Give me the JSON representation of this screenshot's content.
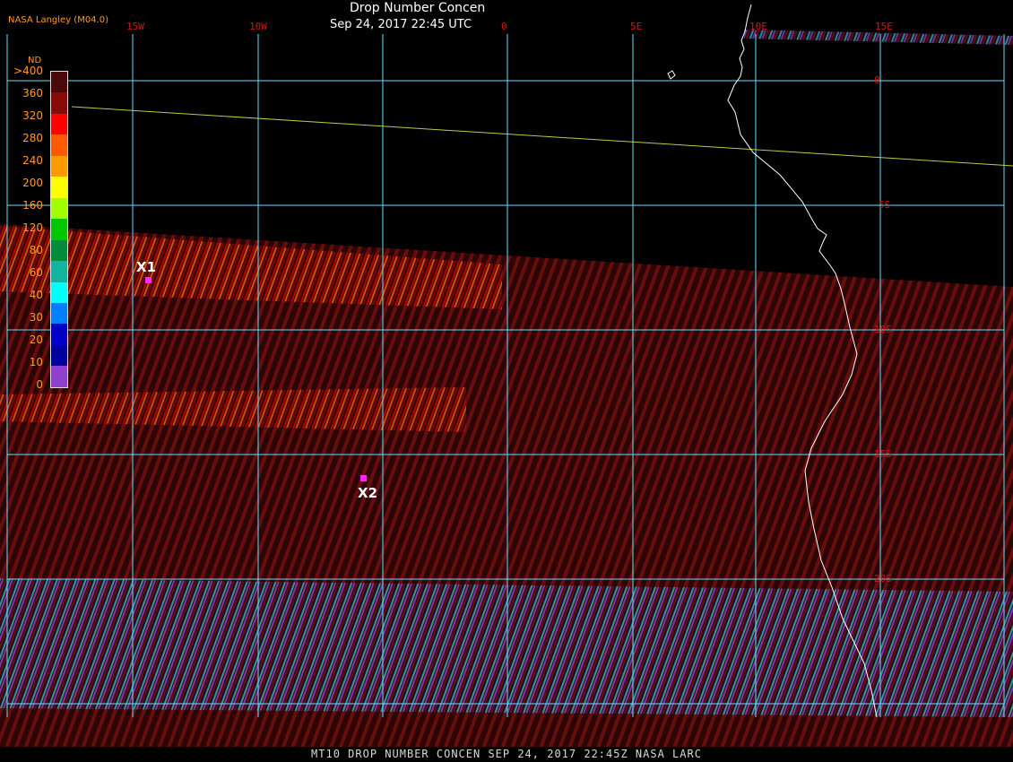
{
  "header": {
    "title": "Drop Number Concen",
    "timestamp": "Sep 24, 2017 22:45 UTC",
    "brand": "NASA Langley (M04.0)"
  },
  "footer": {
    "text": "MT10  DROP NUMBER CONCEN   SEP 24, 2017 22:45Z   NASA LARC"
  },
  "legend": {
    "unit": "ND",
    "labels": [
      ">400",
      "360",
      "320",
      "280",
      "240",
      "200",
      "160",
      "120",
      "80",
      "60",
      "40",
      "30",
      "20",
      "10",
      "0"
    ],
    "colors": [
      "#4a0a0a",
      "#8a0a0a",
      "#ff0000",
      "#ff5a00",
      "#ff9a00",
      "#ffff00",
      "#a0ff00",
      "#00c800",
      "#008c3c",
      "#10b4a0",
      "#00ffff",
      "#0080ff",
      "#0000c8",
      "#0000a0",
      "#9040d0"
    ]
  },
  "grid": {
    "longitudes": [
      "15W",
      "10W",
      "0",
      "5E",
      "10E",
      "15E"
    ],
    "latitudes": [
      "0",
      "5S",
      "10S",
      "15S",
      "20S"
    ]
  },
  "markers": [
    {
      "label": "X1"
    },
    {
      "label": "X2"
    }
  ],
  "colors": {
    "grid": "#5fe0ff",
    "tick_label": "#d41414",
    "coast": "#ffffff",
    "marker": "#ff2af0",
    "data_dark": "#5a0a0a"
  }
}
